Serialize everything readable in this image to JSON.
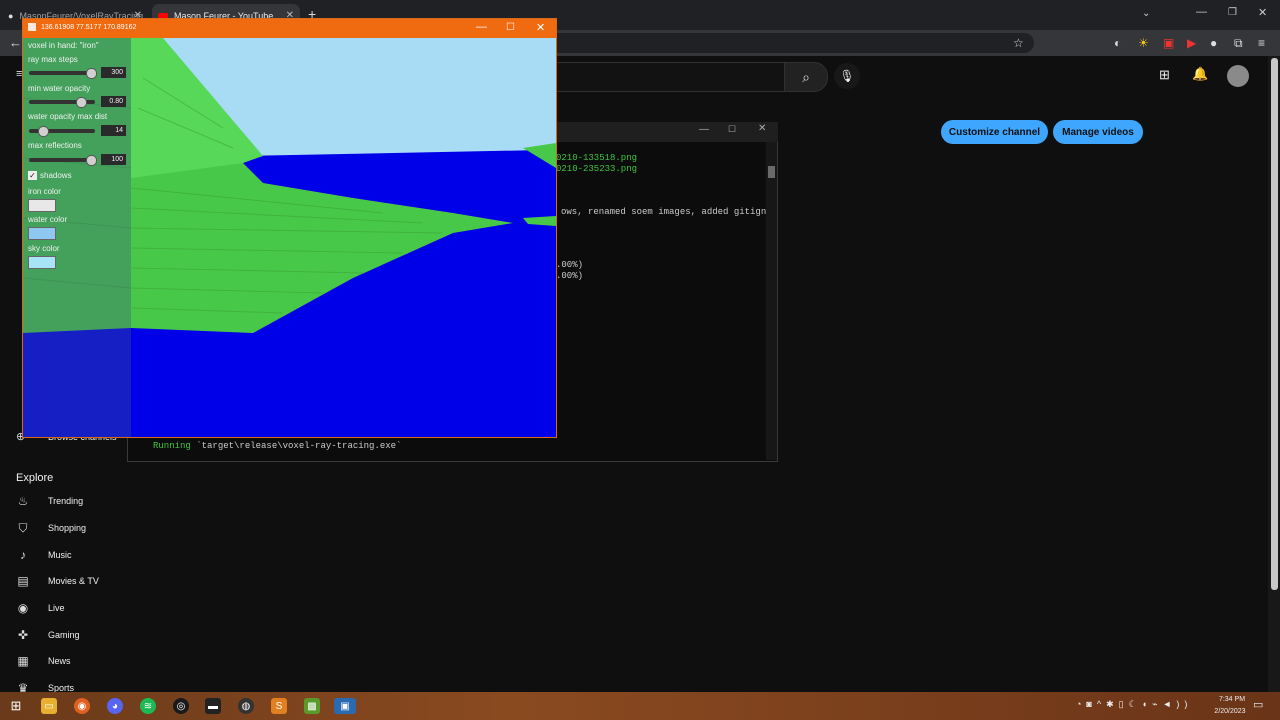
{
  "browser": {
    "tabs": [
      {
        "label": "MasonFeurer/VoxelRayTracing",
        "icon": "github-icon"
      },
      {
        "label": "Mason Feurer - YouTube",
        "icon": "youtube-icon"
      }
    ],
    "new_tab_label": "+",
    "back_label": "←"
  },
  "youtube": {
    "customize_label": "Customize channel",
    "manage_label": "Manage videos",
    "explore_title": "Explore",
    "explore_items": [
      {
        "label": "Trending",
        "icon": "fire-icon"
      },
      {
        "label": "Shopping",
        "icon": "bag-icon"
      },
      {
        "label": "Music",
        "icon": "music-note-icon"
      },
      {
        "label": "Movies & TV",
        "icon": "clapper-icon"
      },
      {
        "label": "Live",
        "icon": "live-icon"
      },
      {
        "label": "Gaming",
        "icon": "gamepad-icon"
      },
      {
        "label": "News",
        "icon": "newspaper-icon"
      },
      {
        "label": "Sports",
        "icon": "trophy-icon"
      }
    ],
    "browse_channels_label": "Browse channels"
  },
  "terminal": {
    "lines": [
      {
        "text": "0210-133518.png",
        "color": "green"
      },
      {
        "text": "0210-235233.png",
        "color": "green"
      },
      {
        "text": "ows, renamed soem images, added gitigno",
        "color": "white"
      },
      {
        "text": ".00%)",
        "color": "white"
      },
      {
        "text": ".00%)",
        "color": "white"
      }
    ],
    "run_keyword": "Running",
    "run_command": "`target\\release\\voxel-ray-tracing.exe`"
  },
  "renderer": {
    "title": "136.61908 77.5177 170.89162",
    "voxel_in_hand": "voxel in hand: \"iron\"",
    "sliders": [
      {
        "label": "ray max steps",
        "value": "300",
        "fraction": 0.95
      },
      {
        "label": "min water opacity",
        "value": "0.80",
        "fraction": 0.8
      },
      {
        "label": "water opacity max dist",
        "value": "14",
        "fraction": 0.18
      },
      {
        "label": "max reflections",
        "value": "100",
        "fraction": 0.95
      }
    ],
    "shadows_label": "shadows",
    "shadows_checked": "✓",
    "colors": [
      {
        "label": "iron color",
        "value": "#e8e8e8"
      },
      {
        "label": "water color",
        "value": "#8ec8f0"
      },
      {
        "label": "sky color",
        "value": "#a8e4f8"
      }
    ]
  },
  "taskbar": {
    "time": "7:34 PM",
    "date": "2/20/2023"
  }
}
